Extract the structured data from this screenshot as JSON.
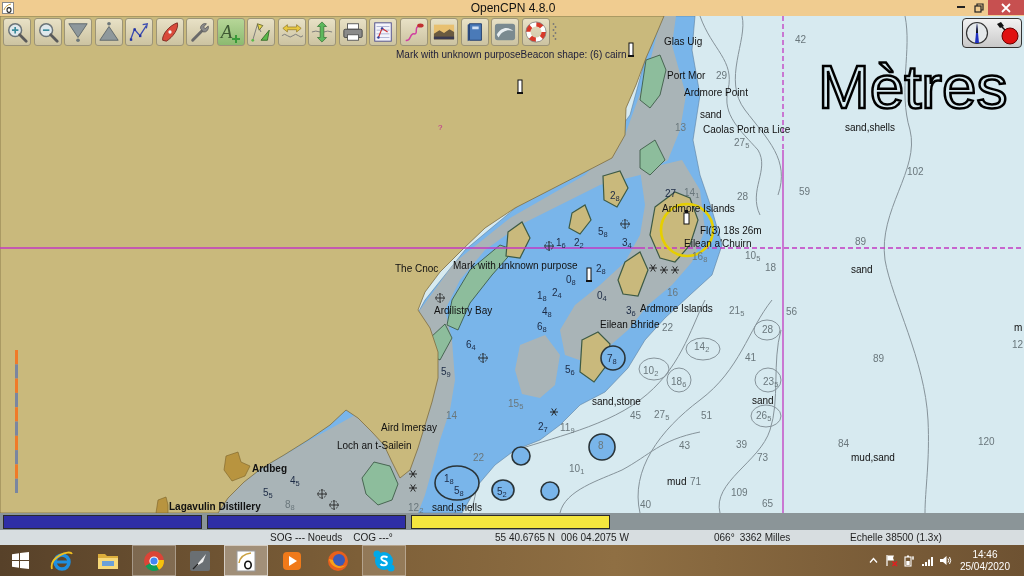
{
  "window": {
    "title": "OpenCPN 4.8.0"
  },
  "toolbar": [
    {
      "kind": "zoom_in",
      "on": false
    },
    {
      "kind": "zoom_out",
      "on": false
    },
    {
      "kind": "scale_in",
      "on": false
    },
    {
      "kind": "scale_out",
      "on": false
    },
    {
      "kind": "route",
      "on": false
    },
    {
      "kind": "ship",
      "on": false
    },
    {
      "kind": "settings",
      "on": false
    },
    {
      "kind": "text",
      "label": "A",
      "on": true
    },
    {
      "kind": "ais",
      "on": false
    },
    {
      "kind": "tide",
      "on": false
    },
    {
      "kind": "current",
      "on": false
    },
    {
      "kind": "print",
      "on": false
    },
    {
      "kind": "route_manager",
      "on": false
    },
    {
      "kind": "track",
      "on": false
    },
    {
      "kind": "color_scheme",
      "on": false
    },
    {
      "kind": "help",
      "on": false
    },
    {
      "kind": "about",
      "on": false
    },
    {
      "kind": "mob",
      "on": false
    }
  ],
  "chart": {
    "rollover": "Mark with unknown purposeBeacon shape: (6) cairn",
    "units": "Mètres",
    "labels": [
      {
        "text": "Glas Uig",
        "kind": "place"
      },
      {
        "text": "42",
        "kind": "depth"
      },
      {
        "text": "Port Mor",
        "kind": "place"
      },
      {
        "text": "29",
        "kind": "depth"
      },
      {
        "text": "Ardmore Point",
        "kind": "place"
      },
      {
        "text": "sand",
        "kind": "seabed"
      },
      {
        "text": "?",
        "kind": "mark"
      },
      {
        "text": "13",
        "kind": "depth"
      },
      {
        "text": "Caolas Port na Lice",
        "kind": "place"
      },
      {
        "text": "sand,shells",
        "kind": "seabed"
      },
      {
        "text": "27$_{5}$",
        "kind": "depth"
      },
      {
        "text": "102",
        "kind": "depth"
      },
      {
        "text": "2$_{8}$",
        "kind": "shoal"
      },
      {
        "text": "27",
        "kind": "shoal"
      },
      {
        "text": "14$_{1}$",
        "kind": "depth"
      },
      {
        "text": "28",
        "kind": "depth"
      },
      {
        "text": "59",
        "kind": "depth"
      },
      {
        "text": "Ardmore Islands",
        "kind": "place"
      },
      {
        "text": "5$_{8}$",
        "kind": "shoal"
      },
      {
        "text": "Fl(3) 18s 26m",
        "kind": "light"
      },
      {
        "text": "1$_{6}$",
        "kind": "shoal"
      },
      {
        "text": "2$_{2}$",
        "kind": "shoal"
      },
      {
        "text": "3$_{4}$",
        "kind": "shoal"
      },
      {
        "text": "Eilean a'Chuirn",
        "kind": "place"
      },
      {
        "text": "89",
        "kind": "depth"
      },
      {
        "text": "16$_{8}$",
        "kind": "depth"
      },
      {
        "text": "10$_{5}$",
        "kind": "depth"
      },
      {
        "text": "The Cnoc",
        "kind": "place"
      },
      {
        "text": "Mark with unknown purpose",
        "kind": "place"
      },
      {
        "text": "2$_{8}$",
        "kind": "shoal"
      },
      {
        "text": "18",
        "kind": "depth"
      },
      {
        "text": "sand",
        "kind": "seabed"
      },
      {
        "text": "0$_{8}$",
        "kind": "shoal"
      },
      {
        "text": "1$_{8}$",
        "kind": "shoal"
      },
      {
        "text": "2$_{4}$",
        "kind": "shoal"
      },
      {
        "text": "0$_{4}$",
        "kind": "shoal"
      },
      {
        "text": "16",
        "kind": "depth"
      },
      {
        "text": "Ardilistry Bay",
        "kind": "place"
      },
      {
        "text": "4$_{8}$",
        "kind": "shoal"
      },
      {
        "text": "3$_{6}$",
        "kind": "shoal"
      },
      {
        "text": "Ardmore Islands",
        "kind": "place"
      },
      {
        "text": "21$_{5}$",
        "kind": "depth"
      },
      {
        "text": "56",
        "kind": "depth"
      },
      {
        "text": "6$_{8}$",
        "kind": "shoal"
      },
      {
        "text": "Eilean Bhride",
        "kind": "place"
      },
      {
        "text": "22",
        "kind": "depth"
      },
      {
        "text": "28",
        "kind": "depth"
      },
      {
        "text": "m",
        "kind": "seabed"
      },
      {
        "text": "6$_{4}$",
        "kind": "shoal"
      },
      {
        "text": "14$_{2}$",
        "kind": "depth"
      },
      {
        "text": "12",
        "kind": "depth"
      },
      {
        "text": "7$_{8}$",
        "kind": "shoal"
      },
      {
        "text": "41",
        "kind": "depth"
      },
      {
        "text": "89",
        "kind": "depth"
      },
      {
        "text": "5$_{9}$",
        "kind": "shoal"
      },
      {
        "text": "5$_{6}$",
        "kind": "shoal"
      },
      {
        "text": "10$_{2}$",
        "kind": "depth"
      },
      {
        "text": "18$_{6}$",
        "kind": "depth"
      },
      {
        "text": "23$_{5}$",
        "kind": "depth"
      },
      {
        "text": "15$_{5}$",
        "kind": "depth"
      },
      {
        "text": "sand,stone",
        "kind": "seabed"
      },
      {
        "text": "sand",
        "kind": "seabed"
      },
      {
        "text": "14",
        "kind": "depth"
      },
      {
        "text": "45",
        "kind": "depth"
      },
      {
        "text": "27$_{5}$",
        "kind": "depth"
      },
      {
        "text": "51",
        "kind": "depth"
      },
      {
        "text": "26$_{5}$",
        "kind": "depth"
      },
      {
        "text": "Aird Imersay",
        "kind": "place"
      },
      {
        "text": "2$_{7}$",
        "kind": "shoal"
      },
      {
        "text": "11$_{9}$",
        "kind": "depth"
      },
      {
        "text": "Loch an t-Sailein",
        "kind": "place"
      },
      {
        "text": "8",
        "kind": "depth"
      },
      {
        "text": "43",
        "kind": "depth"
      },
      {
        "text": "39",
        "kind": "depth"
      },
      {
        "text": "84",
        "kind": "depth"
      },
      {
        "text": "120",
        "kind": "depth"
      },
      {
        "text": "22",
        "kind": "depth"
      },
      {
        "text": "73",
        "kind": "depth"
      },
      {
        "text": "mud,sand",
        "kind": "seabed"
      },
      {
        "text": "Ardbeg",
        "kind": "bold_place"
      },
      {
        "text": "10$_{1}$",
        "kind": "depth"
      },
      {
        "text": "4$_{5}$",
        "kind": "shoal"
      },
      {
        "text": "1$_{8}$",
        "kind": "shoal"
      },
      {
        "text": "mud",
        "kind": "seabed"
      },
      {
        "text": "71",
        "kind": "depth"
      },
      {
        "text": "5$_{5}$",
        "kind": "shoal"
      },
      {
        "text": "5$_{8}$",
        "kind": "shoal"
      },
      {
        "text": "5$_{2}$",
        "kind": "shoal"
      },
      {
        "text": "109",
        "kind": "depth"
      },
      {
        "text": "Lagavulin Distillery",
        "kind": "bold_place"
      },
      {
        "text": "8$_{8}$",
        "kind": "depth"
      },
      {
        "text": "12$_{2}$",
        "kind": "depth"
      },
      {
        "text": "sand,shells",
        "kind": "seabed"
      },
      {
        "text": "40",
        "kind": "depth"
      },
      {
        "text": "65",
        "kind": "depth"
      }
    ]
  },
  "chart_bar": [
    {
      "color": "#2e2ea6"
    },
    {
      "color": "#2e2ea6"
    },
    {
      "color": "#f4e63e"
    }
  ],
  "status_bar": {
    "sog": "SOG --- Noeuds",
    "cog": "COG ---°",
    "lat": "55 40.6765 N",
    "lon": "006 04.2075 W",
    "bearing": "066°",
    "distance": "3362 Milles",
    "scale": "Echelle 38500 (1.3x)"
  },
  "taskbar": {
    "apps": [
      {
        "kind": "browser_e",
        "running": false,
        "selected": false
      },
      {
        "kind": "folder",
        "running": false,
        "selected": false
      },
      {
        "kind": "browser_round",
        "running": true,
        "selected": false
      },
      {
        "kind": "quill",
        "running": false,
        "selected": false
      },
      {
        "kind": "chart_app",
        "running": true,
        "selected": true
      },
      {
        "kind": "player",
        "running": false,
        "selected": false
      },
      {
        "kind": "browser_fox",
        "running": false,
        "selected": false
      },
      {
        "kind": "chat",
        "running": true,
        "selected": false
      }
    ],
    "time": "14:46",
    "date": "25/04/2020"
  }
}
